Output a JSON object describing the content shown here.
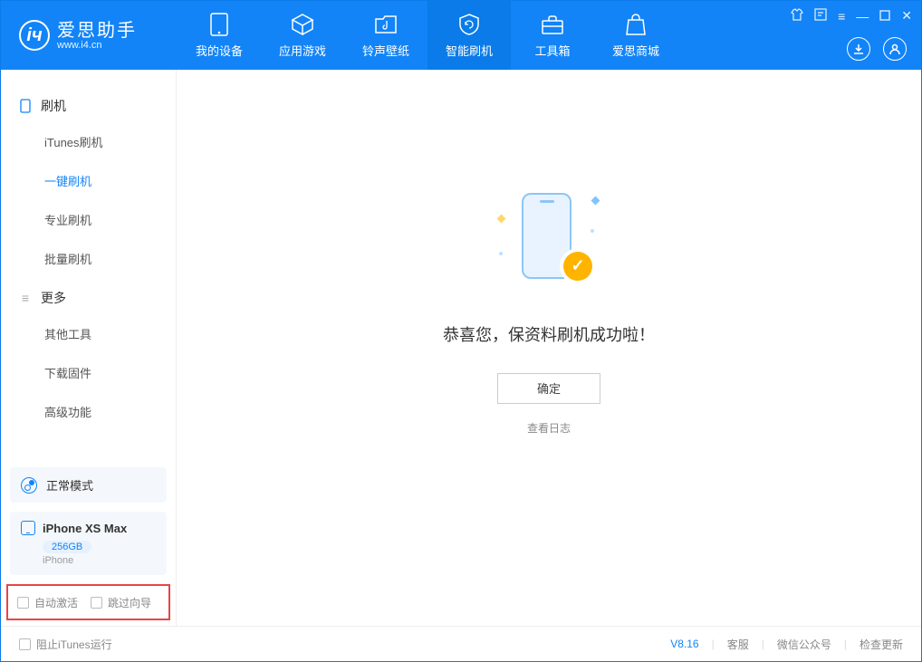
{
  "header": {
    "app_name": "爱思助手",
    "app_url": "www.i4.cn",
    "tabs": [
      {
        "label": "我的设备"
      },
      {
        "label": "应用游戏"
      },
      {
        "label": "铃声壁纸"
      },
      {
        "label": "智能刷机"
      },
      {
        "label": "工具箱"
      },
      {
        "label": "爱思商城"
      }
    ]
  },
  "sidebar": {
    "group1_title": "刷机",
    "group1": [
      {
        "label": "iTunes刷机"
      },
      {
        "label": "一键刷机"
      },
      {
        "label": "专业刷机"
      },
      {
        "label": "批量刷机"
      }
    ],
    "group2_title": "更多",
    "group2": [
      {
        "label": "其他工具"
      },
      {
        "label": "下载固件"
      },
      {
        "label": "高级功能"
      }
    ],
    "mode_label": "正常模式",
    "device": {
      "name": "iPhone XS Max",
      "storage": "256GB",
      "type": "iPhone"
    },
    "check_auto": "自动激活",
    "check_skip": "跳过向导"
  },
  "main": {
    "success": "恭喜您，保资料刷机成功啦！",
    "ok": "确定",
    "view_log": "查看日志"
  },
  "footer": {
    "block_itunes": "阻止iTunes运行",
    "version": "V8.16",
    "support": "客服",
    "wechat": "微信公众号",
    "update": "检查更新"
  }
}
